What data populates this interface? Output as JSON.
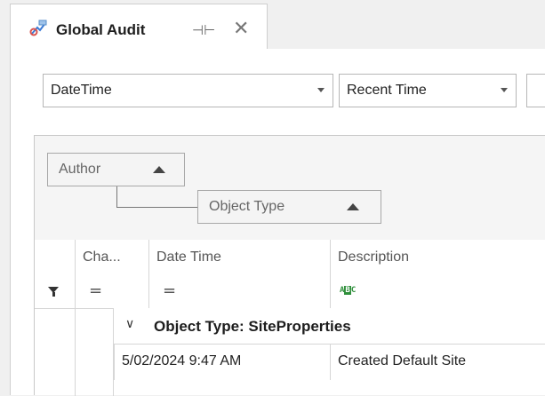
{
  "tab": {
    "title": "Global Audit",
    "icon": "global-audit-icon",
    "pin_icon": "pin-icon",
    "close_icon": "close-icon"
  },
  "filters": {
    "field": "DateTime",
    "range": "Recent Time",
    "third": ""
  },
  "group_panel": {
    "groups": [
      "Author",
      "Object Type"
    ]
  },
  "columns": [
    "Cha...",
    "Date Time",
    "Description"
  ],
  "filter_row": {
    "equals": "=",
    "description_icon": "text-filter-icon"
  },
  "group_row": {
    "label": "Object Type: SiteProperties"
  },
  "rows": [
    {
      "date_time": "5/02/2024 9:47 AM",
      "description": "Created Default Site"
    }
  ],
  "colors": {
    "accent_green": "#2f8f3b",
    "border": "#d6d6d6"
  }
}
